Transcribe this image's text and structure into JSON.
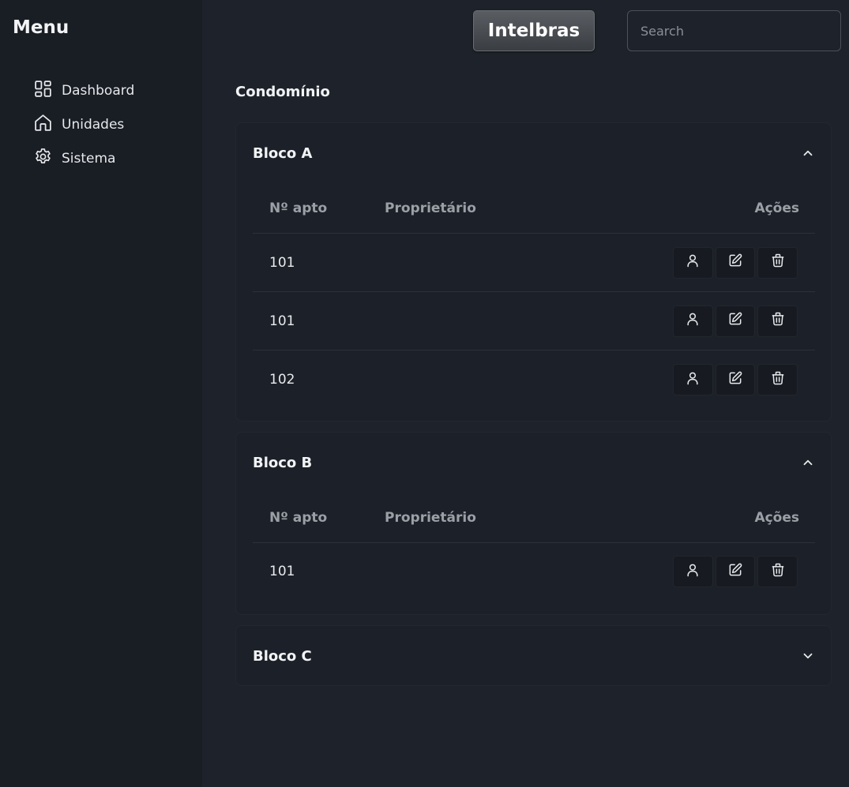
{
  "sidebar": {
    "title": "Menu",
    "items": [
      {
        "label": "Dashboard",
        "icon": "dashboard-icon"
      },
      {
        "label": "Unidades",
        "icon": "home-icon"
      },
      {
        "label": "Sistema",
        "icon": "gear-icon"
      }
    ]
  },
  "header": {
    "brand": "Intelbras",
    "search_placeholder": "Search"
  },
  "main": {
    "title": "Condomínio",
    "columns": {
      "apt": "Nº apto",
      "owner": "Proprietário",
      "actions": "Ações"
    },
    "blocks": [
      {
        "name": "Bloco A",
        "expanded": true,
        "rows": [
          {
            "apt": "101",
            "owner": ""
          },
          {
            "apt": "101",
            "owner": ""
          },
          {
            "apt": "102",
            "owner": ""
          }
        ]
      },
      {
        "name": "Bloco B",
        "expanded": true,
        "rows": [
          {
            "apt": "101",
            "owner": ""
          }
        ]
      },
      {
        "name": "Bloco C",
        "expanded": false,
        "rows": []
      }
    ]
  },
  "colors": {
    "background": "#1e232b",
    "sidebar": "#191d24",
    "muted_text": "#9ba0a7"
  }
}
